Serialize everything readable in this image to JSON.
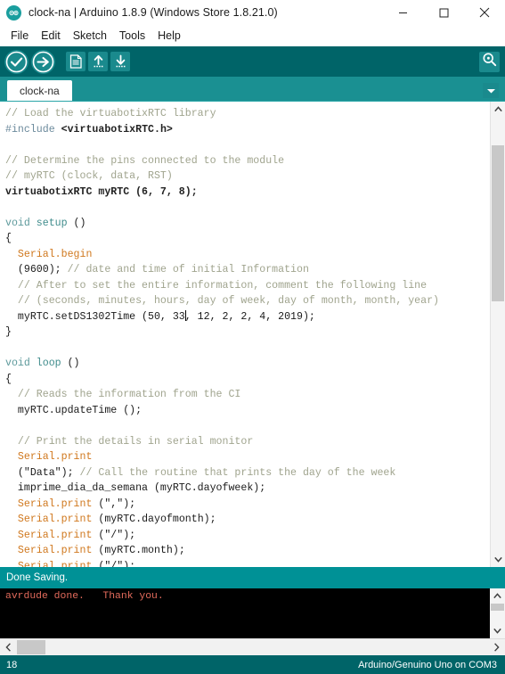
{
  "window": {
    "title": "clock-na | Arduino 1.8.9 (Windows Store 1.8.21.0)",
    "logo_icon": "arduino-logo-icon",
    "controls": {
      "minimize": "minimize-icon",
      "maximize": "maximize-icon",
      "close": "close-icon"
    }
  },
  "menubar": {
    "items": [
      {
        "label": "File"
      },
      {
        "label": "Edit"
      },
      {
        "label": "Sketch"
      },
      {
        "label": "Tools"
      },
      {
        "label": "Help"
      }
    ]
  },
  "toolbar": {
    "buttons": [
      {
        "name": "verify-button",
        "icon": "checkmark-icon",
        "label": "Verify"
      },
      {
        "name": "upload-button",
        "icon": "arrow-right-icon",
        "label": "Upload"
      },
      {
        "name": "new-button",
        "icon": "new-document-icon",
        "label": "New"
      },
      {
        "name": "open-button",
        "icon": "arrow-up-icon",
        "label": "Open"
      },
      {
        "name": "save-button",
        "icon": "arrow-down-icon",
        "label": "Save"
      }
    ],
    "serial_monitor": {
      "icon": "magnifier-icon",
      "label": "Serial Monitor"
    }
  },
  "tabs": {
    "items": [
      {
        "label": "clock-na",
        "active": true
      }
    ],
    "menu_icon": "chevron-down-icon"
  },
  "editor": {
    "lines": [
      {
        "tokens": [
          {
            "t": "// Load the virtuabotixRTC library",
            "c": "comment"
          }
        ]
      },
      {
        "tokens": [
          {
            "t": "#include ",
            "c": "preproc"
          },
          {
            "t": "<virtuabotixRTC.h>",
            "c": "lib"
          }
        ]
      },
      {
        "tokens": [
          {
            "t": "",
            "c": "plain"
          }
        ]
      },
      {
        "tokens": [
          {
            "t": "// Determine the pins connected to the module",
            "c": "comment"
          }
        ]
      },
      {
        "tokens": [
          {
            "t": "// myRTC (clock, data, RST)",
            "c": "comment"
          }
        ]
      },
      {
        "tokens": [
          {
            "t": "virtuabotixRTC myRTC (6, 7, 8);",
            "c": "lib"
          }
        ]
      },
      {
        "tokens": [
          {
            "t": "",
            "c": "plain"
          }
        ]
      },
      {
        "tokens": [
          {
            "t": "void ",
            "c": "keyword"
          },
          {
            "t": "setup ",
            "c": "func"
          },
          {
            "t": "()",
            "c": "plain"
          }
        ]
      },
      {
        "tokens": [
          {
            "t": "{",
            "c": "plain"
          }
        ]
      },
      {
        "tokens": [
          {
            "t": "  Serial.begin",
            "c": "obj"
          }
        ]
      },
      {
        "tokens": [
          {
            "t": "  (9600); ",
            "c": "plain"
          },
          {
            "t": "// date and time of initial Information",
            "c": "comment"
          }
        ]
      },
      {
        "tokens": [
          {
            "t": "  // After to set the entire information, comment the following line",
            "c": "comment"
          }
        ]
      },
      {
        "tokens": [
          {
            "t": "  // (seconds, minutes, hours, day of week, day of month, month, year)",
            "c": "comment"
          }
        ]
      },
      {
        "tokens": [
          {
            "t": "  myRTC.setDS1302Time (50, 33",
            "c": "plain"
          },
          {
            "t": "CARET",
            "c": "caret"
          },
          {
            "t": ", 12, 2, 2, 4, 2019);",
            "c": "plain"
          }
        ]
      },
      {
        "tokens": [
          {
            "t": "}",
            "c": "plain"
          }
        ]
      },
      {
        "tokens": [
          {
            "t": "",
            "c": "plain"
          }
        ]
      },
      {
        "tokens": [
          {
            "t": "void ",
            "c": "keyword"
          },
          {
            "t": "loop ",
            "c": "func"
          },
          {
            "t": "()",
            "c": "plain"
          }
        ]
      },
      {
        "tokens": [
          {
            "t": "{",
            "c": "plain"
          }
        ]
      },
      {
        "tokens": [
          {
            "t": "  // Reads the information from the CI",
            "c": "comment"
          }
        ]
      },
      {
        "tokens": [
          {
            "t": "  myRTC.updateTime ();",
            "c": "plain"
          }
        ]
      },
      {
        "tokens": [
          {
            "t": "",
            "c": "plain"
          }
        ]
      },
      {
        "tokens": [
          {
            "t": "  // Print the details in serial monitor",
            "c": "comment"
          }
        ]
      },
      {
        "tokens": [
          {
            "t": "  Serial.print",
            "c": "obj"
          }
        ]
      },
      {
        "tokens": [
          {
            "t": "  (\"Data\"); ",
            "c": "plain"
          },
          {
            "t": "// Call the routine that prints the day of the week",
            "c": "comment"
          }
        ]
      },
      {
        "tokens": [
          {
            "t": "  imprime_dia_da_semana (myRTC.dayofweek);",
            "c": "plain"
          }
        ]
      },
      {
        "tokens": [
          {
            "t": "  Serial.print ",
            "c": "obj"
          },
          {
            "t": "(\",\");",
            "c": "plain"
          }
        ]
      },
      {
        "tokens": [
          {
            "t": "  Serial.print ",
            "c": "obj"
          },
          {
            "t": "(myRTC.dayofmonth);",
            "c": "plain"
          }
        ]
      },
      {
        "tokens": [
          {
            "t": "  Serial.print ",
            "c": "obj"
          },
          {
            "t": "(\"/\");",
            "c": "plain"
          }
        ]
      },
      {
        "tokens": [
          {
            "t": "  Serial.print ",
            "c": "obj"
          },
          {
            "t": "(myRTC.month);",
            "c": "plain"
          }
        ]
      },
      {
        "tokens": [
          {
            "t": "  Serial.print ",
            "c": "obj"
          },
          {
            "t": "(\"/\");",
            "c": "plain"
          }
        ]
      }
    ]
  },
  "status_message": "Done Saving.",
  "console": {
    "text": "avrdude done.   Thank you."
  },
  "statusbar": {
    "line_number": "18",
    "board_info": "Arduino/Genuino Uno on COM3"
  },
  "colors": {
    "toolbar_bg": "#006468",
    "tabbar_bg": "#1a9092",
    "status_bg": "#009196",
    "console_bg": "#000000",
    "console_text": "#e36b5c",
    "comment": "#a0a48e",
    "keyword": "#5e9a9c",
    "object": "#d0781e"
  }
}
